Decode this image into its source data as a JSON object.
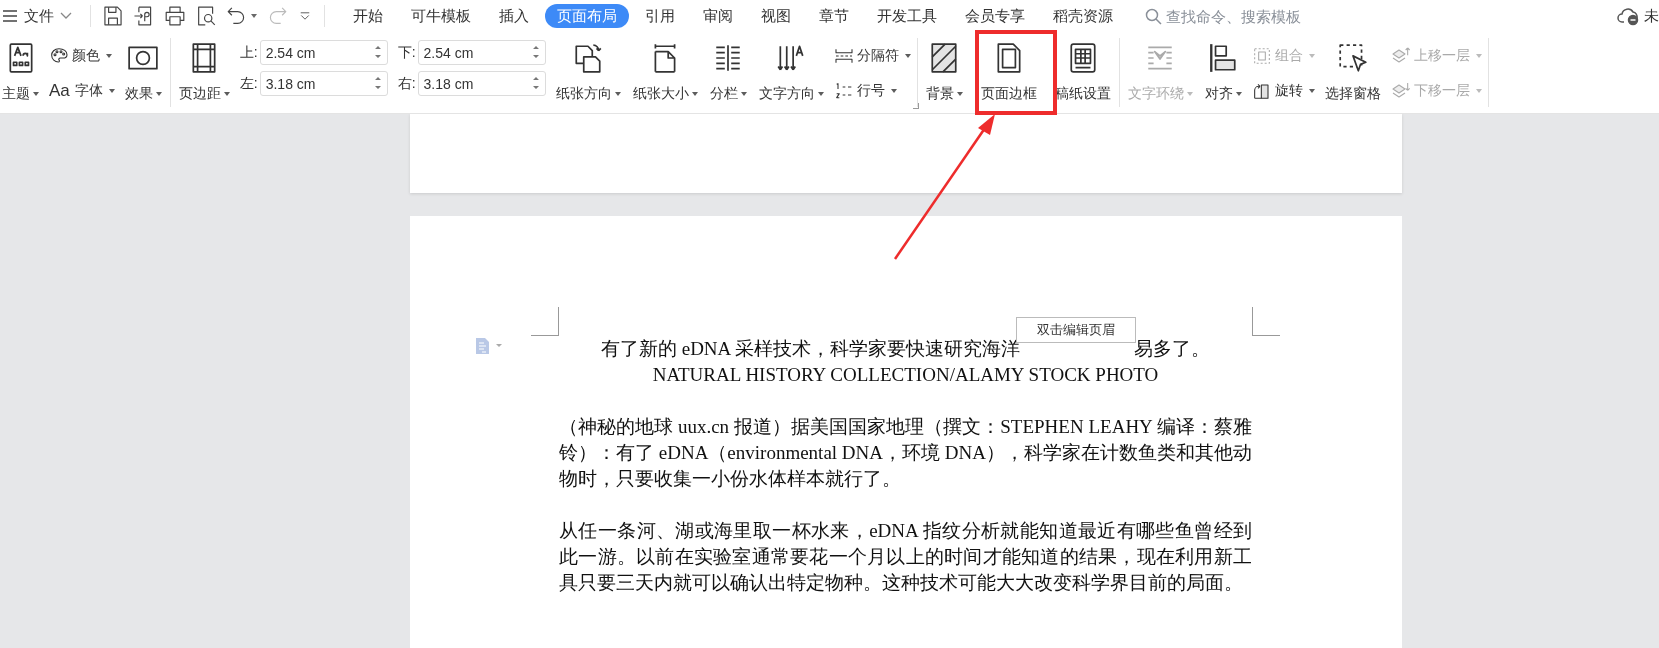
{
  "menu": {
    "label": "文件"
  },
  "quick_access": [
    {
      "kind": "save",
      "disabled": false
    },
    {
      "kind": "export",
      "disabled": false
    },
    {
      "kind": "print",
      "disabled": false
    },
    {
      "kind": "preview",
      "disabled": false
    },
    {
      "kind": "undo",
      "disabled": false,
      "dropdown": true
    },
    {
      "kind": "redo",
      "disabled": true
    },
    {
      "kind": "customize",
      "disabled": false
    }
  ],
  "tabs": [
    {
      "label": "开始",
      "selected": false
    },
    {
      "label": "可牛模板",
      "selected": false
    },
    {
      "label": "插入",
      "selected": false
    },
    {
      "label": "页面布局",
      "selected": true
    },
    {
      "label": "引用",
      "selected": false
    },
    {
      "label": "审阅",
      "selected": false
    },
    {
      "label": "视图",
      "selected": false
    },
    {
      "label": "章节",
      "selected": false
    },
    {
      "label": "开发工具",
      "selected": false
    },
    {
      "label": "会员专享",
      "selected": false
    },
    {
      "label": "稻壳资源",
      "selected": false
    }
  ],
  "search": {
    "placeholder": "查找命令、搜索模板"
  },
  "sync_status": "未",
  "ribbon": {
    "groups": [
      {
        "items": [
          {
            "kind": "large",
            "label": "主题",
            "dropdown": true,
            "disabled": false
          },
          {
            "kind": "stack",
            "rows": [
              {
                "label": "颜色",
                "dropdown": true,
                "disabled": false
              },
              {
                "glyph": "Aa",
                "label": "字体",
                "dropdown": true,
                "disabled": false
              }
            ]
          },
          {
            "kind": "large",
            "label": "效果",
            "dropdown": true,
            "disabled": false
          }
        ]
      },
      {
        "launcher": true,
        "items": [
          {
            "kind": "large",
            "label": "页边距",
            "dropdown": true,
            "disabled": false
          },
          {
            "kind": "fields",
            "fields": [
              {
                "label": "上:",
                "value": "2.54 cm"
              },
              {
                "label": "下:",
                "value": "2.54 cm"
              },
              {
                "label": "左:",
                "value": "3.18 cm"
              },
              {
                "label": "右:",
                "value": "3.18 cm"
              }
            ]
          },
          {
            "kind": "large",
            "label": "纸张方向",
            "dropdown": true,
            "disabled": false
          },
          {
            "kind": "large",
            "label": "纸张大小",
            "dropdown": true,
            "disabled": false
          },
          {
            "kind": "large",
            "label": "分栏",
            "dropdown": true,
            "disabled": false
          },
          {
            "kind": "large",
            "label": "文字方向",
            "dropdown": true,
            "disabled": false
          },
          {
            "kind": "stack",
            "rows": [
              {
                "label": "分隔符",
                "dropdown": true,
                "disabled": false
              },
              {
                "label": "行号",
                "dropdown": true,
                "disabled": false
              }
            ]
          }
        ]
      },
      {
        "items": [
          {
            "kind": "large",
            "label": "背景",
            "dropdown": true,
            "disabled": false
          },
          {
            "kind": "large",
            "label": "页面边框",
            "dropdown": false,
            "disabled": false
          },
          {
            "kind": "large",
            "label": "稿纸设置",
            "dropdown": false,
            "disabled": false
          }
        ]
      },
      {
        "items": [
          {
            "kind": "large",
            "label": "文字环绕",
            "dropdown": true,
            "disabled": true
          },
          {
            "kind": "large",
            "label": "对齐",
            "dropdown": true,
            "disabled": false
          },
          {
            "kind": "stack",
            "rows": [
              {
                "label": "组合",
                "dropdown": true,
                "disabled": true
              },
              {
                "label": "旋转",
                "dropdown": true,
                "disabled": false
              }
            ]
          },
          {
            "kind": "large",
            "label": "选择窗格",
            "dropdown": false,
            "disabled": false
          },
          {
            "kind": "stack",
            "rows": [
              {
                "label": "上移一层",
                "dropdown": true,
                "disabled": true
              },
              {
                "label": "下移一层",
                "dropdown": true,
                "disabled": true
              }
            ]
          }
        ]
      }
    ]
  },
  "document": {
    "header_hint": "双击编辑页眉",
    "caption": {
      "before_tooltip": "有了新的 eDNA 采样技术，科学家要快速研究海洋",
      "after_tooltip": "易多了。",
      "credit": "NATURAL HISTORY COLLECTION/ALAMY STOCK PHOTO"
    },
    "paragraphs": [
      "（神秘的地球 uux.cn 报道）据美国国家地理（撰文：STEPHEN LEAHY  编译：蔡雅铃）：有了 eDNA（environmental DNA，环境 DNA），科学家在计数鱼类和其他动物时，只要收集一小份水体样本就行了。",
      "从任一条河、湖或海里取一杯水来，eDNA 指纹分析就能知道最近有哪些鱼曾经到此一游。以前在实验室通常要花一个月以上的时间才能知道的结果，现在利用新工具只要三天内就可以确认出特定物种。这种技术可能大大改变科学界目前的局面。"
    ]
  }
}
